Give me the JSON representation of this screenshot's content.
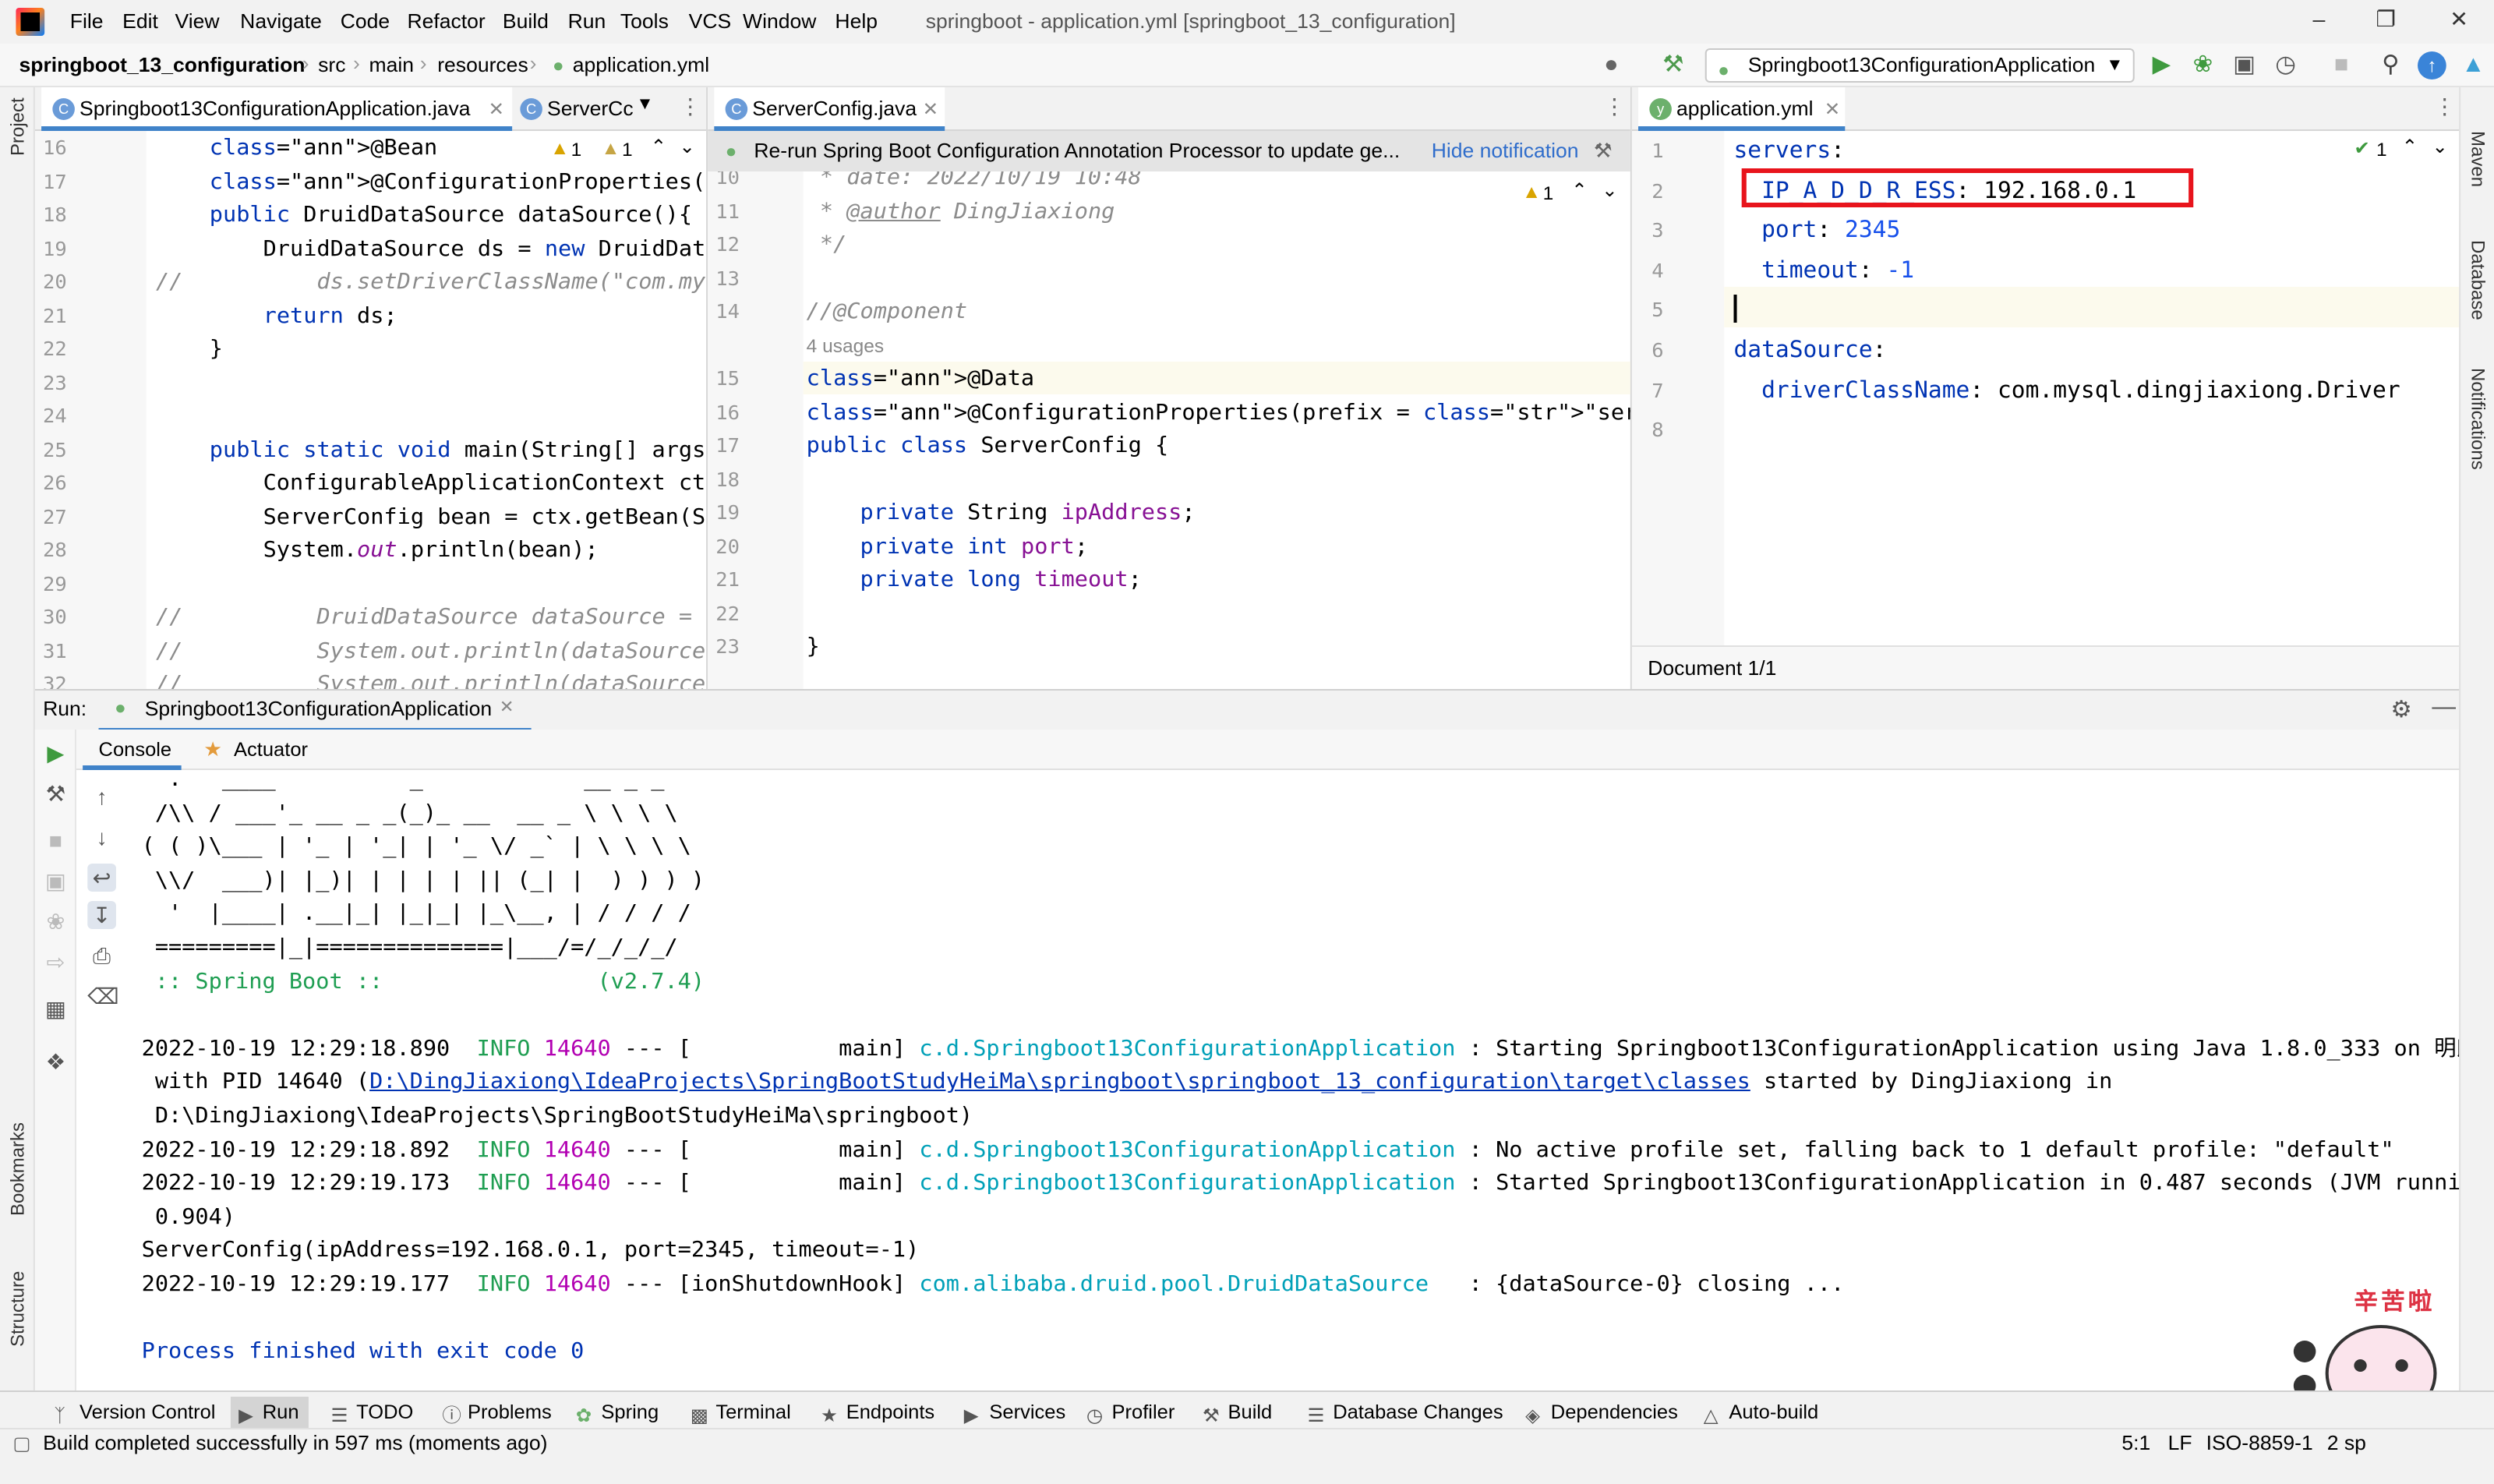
{
  "window": {
    "title": "springboot - application.yml [springboot_13_configuration]",
    "menu": [
      "File",
      "Edit",
      "View",
      "Navigate",
      "Code",
      "Refactor",
      "Build",
      "Run",
      "Tools",
      "VCS",
      "Window",
      "Help"
    ]
  },
  "breadcrumb": [
    "springboot_13_configuration",
    "src",
    "main",
    "resources",
    "application.yml"
  ],
  "run_config": "Springboot13ConfigurationApplication",
  "left_stripe": [
    "Project",
    "Bookmarks",
    "Structure"
  ],
  "right_stripe": [
    "Maven",
    "Database",
    "Notifications"
  ],
  "editor_left": {
    "tabs": [
      "Springboot13ConfigurationApplication.java",
      "ServerCc"
    ],
    "inspection": {
      "warn": "1",
      "weak": "1"
    },
    "lines": [
      {
        "n": "16",
        "code": "    @Bean"
      },
      {
        "n": "17",
        "code": "    @ConfigurationProperties(prefix = \"datas"
      },
      {
        "n": "18",
        "code": "    public DruidDataSource dataSource(){"
      },
      {
        "n": "19",
        "code": "        DruidDataSource ds = new DruidDataSo"
      },
      {
        "n": "20",
        "code": "//          ds.setDriverClassName(\"com.mysql.j"
      },
      {
        "n": "21",
        "code": "        return ds;"
      },
      {
        "n": "22",
        "code": "    }"
      },
      {
        "n": "23",
        "code": ""
      },
      {
        "n": "24",
        "code": ""
      },
      {
        "n": "25",
        "code": "    public static void main(String[] args) {"
      },
      {
        "n": "26",
        "code": "        ConfigurableApplicationContext ctx ="
      },
      {
        "n": "27",
        "code": "        ServerConfig bean = ctx.getBean(Serv"
      },
      {
        "n": "28",
        "code": "        System.out.println(bean);"
      },
      {
        "n": "29",
        "code": ""
      },
      {
        "n": "30",
        "code": "//          DruidDataSource dataSource = ctx.g"
      },
      {
        "n": "31",
        "code": "//          System.out.println(dataSource.getD"
      },
      {
        "n": "32",
        "code": "//          System.out.println(dataSource);"
      }
    ]
  },
  "editor_mid": {
    "tab": "ServerConfig.java",
    "notification": "Re-run Spring Boot Configuration Annotation Processor to update ge...",
    "hide_link": "Hide notification",
    "inspection_warn": "1",
    "usages": "4 usages",
    "lines": [
      {
        "n": "10",
        "code": " * date: 2022/10/19 10:48"
      },
      {
        "n": "11",
        "code": " * @author DingJiaxiong"
      },
      {
        "n": "12",
        "code": " */"
      },
      {
        "n": "13",
        "code": ""
      },
      {
        "n": "14",
        "code": "//@Component"
      },
      {
        "n": "15",
        "code": "@Data"
      },
      {
        "n": "16",
        "code": "@ConfigurationProperties(prefix = \"servers\")"
      },
      {
        "n": "17",
        "code": "public class ServerConfig {"
      },
      {
        "n": "18",
        "code": ""
      },
      {
        "n": "19",
        "code": "    private String ipAddress;"
      },
      {
        "n": "20",
        "code": "    private int port;"
      },
      {
        "n": "21",
        "code": "    private long timeout;"
      },
      {
        "n": "22",
        "code": ""
      },
      {
        "n": "23",
        "code": "}"
      }
    ]
  },
  "editor_right": {
    "tab": "application.yml",
    "inspection_ok": "1",
    "status": "Document 1/1",
    "lines": [
      {
        "n": "1",
        "key": "servers",
        "val": ""
      },
      {
        "n": "2",
        "key": "  IP_A_D_D_R_ESS",
        "val": " 192.168.0.1"
      },
      {
        "n": "3",
        "key": "  port",
        "val": " 2345"
      },
      {
        "n": "4",
        "key": "  timeout",
        "val": " -1"
      },
      {
        "n": "5",
        "key": "",
        "val": ""
      },
      {
        "n": "6",
        "key": "dataSource",
        "val": ""
      },
      {
        "n": "7",
        "key": "  driverClassName",
        "val": " com.mysql.dingjiaxiong.Driver"
      },
      {
        "n": "8",
        "key": "",
        "val": ""
      }
    ]
  },
  "run": {
    "label": "Run:",
    "tab": "Springboot13ConfigurationApplication",
    "subtabs": [
      "Console",
      "Actuator"
    ],
    "banner": [
      "  .   ____          _            __ _ _",
      " /\\\\ / ___'_ __ _ _(_)_ __  __ _ \\ \\ \\ \\",
      "( ( )\\___ | '_ | '_| | '_ \\/ _` | \\ \\ \\ \\",
      " \\\\/  ___)| |_)| | | | | || (_| |  ) ) ) )",
      "  '  |____| .__|_| |_|_| |_\\__, | / / / /",
      " =========|_|==============|___/=/_/_/_/",
      " :: Spring Boot ::                (v2.7.4)"
    ],
    "log": [
      {
        "ts": "2022-10-19 12:29:18.890",
        "level": "INFO",
        "pid": "14640",
        "thread": "--- [           main]",
        "logger": "c.d.Springboot13ConfigurationApplication",
        "msg": " : Starting Springboot13ConfigurationApplication using Java 1.8.0_333 on 明朗散发弄扁舟"
      },
      {
        "ts": "2022-10-19 12:29:18.892",
        "level": "INFO",
        "pid": "14640",
        "thread": "--- [           main]",
        "logger": "c.d.Springboot13ConfigurationApplication",
        "msg": " : No active profile set, falling back to 1 default profile: \"default\""
      },
      {
        "ts": "2022-10-19 12:29:19.173",
        "level": "INFO",
        "pid": "14640",
        "thread": "--- [           main]",
        "logger": "c.d.Springboot13ConfigurationApplication",
        "msg": " : Started Springboot13ConfigurationApplication in 0.487 seconds (JVM running for"
      },
      {
        "ts": "2022-10-19 12:29:19.177",
        "level": "INFO",
        "pid": "14640",
        "thread": "--- [ionShutdownHook]",
        "logger": "com.alibaba.druid.pool.DruidDataSource",
        "msg": "   : {dataSource-0} closing ..."
      }
    ],
    "pid_line_prefix": " with PID 14640 (",
    "pid_line_link": "D:\\DingJiaxiong\\IdeaProjects\\SpringBootStudyHeiMa\\springboot\\springboot_13_configuration\\target\\classes",
    "pid_line_suffix": " started by DingJiaxiong in",
    "pid_line2": " D:\\DingJiaxiong\\IdeaProjects\\SpringBootStudyHeiMa\\springboot)",
    "jvm_cont": " 0.904)",
    "server_config_out": "ServerConfig(ipAddress=192.168.0.1, port=2345, timeout=-1)",
    "exit": "Process finished with exit code 0"
  },
  "tool_windows": [
    "Version Control",
    "Run",
    "TODO",
    "Problems",
    "Spring",
    "Terminal",
    "Endpoints",
    "Services",
    "Profiler",
    "Build",
    "Database Changes",
    "Dependencies",
    "Auto-build"
  ],
  "status": {
    "message": "Build completed successfully in 597 ms (moments ago)",
    "position": "5:1",
    "line_sep": "LF",
    "encoding": "ISO-8859-1",
    "indent": "2 sp"
  },
  "sticker_text": "辛苦啦",
  "colors": {
    "highlight_box": "#e8141c",
    "accent": "#4083c9"
  }
}
